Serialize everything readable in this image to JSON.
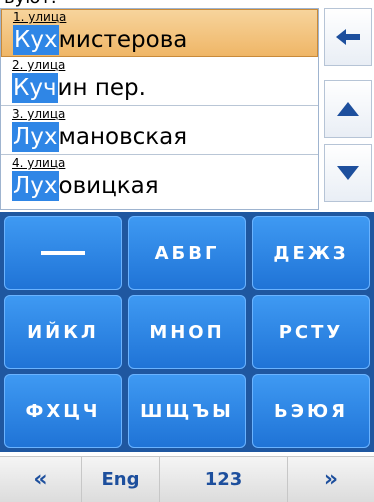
{
  "top_clip_text": "вуют.",
  "list": {
    "items": [
      {
        "caption": "1. улица",
        "prefix": "Кух",
        "rest": "мистерова",
        "selected": true
      },
      {
        "caption": "2. улица",
        "prefix": "Куч",
        "rest": "ин пер.",
        "selected": false
      },
      {
        "caption": "3. улица",
        "prefix": "Лух",
        "rest": "мановская",
        "selected": false
      },
      {
        "caption": "4. улица",
        "prefix": "Лух",
        "rest": "овицкая",
        "selected": false
      }
    ]
  },
  "side_buttons": [
    {
      "icon": "arrow-left-icon"
    },
    {
      "icon": "triangle-up-icon"
    },
    {
      "icon": "triangle-down-icon"
    }
  ],
  "keyboard": {
    "keys": [
      {
        "label": "—"
      },
      {
        "label": "АБВГ"
      },
      {
        "label": "ДЕЖЗ"
      },
      {
        "label": "ИЙКЛ"
      },
      {
        "label": "МНОП"
      },
      {
        "label": "РСТУ"
      },
      {
        "label": "ФХЦЧ"
      },
      {
        "label": "ШЩЪЫ"
      },
      {
        "label": "ЬЭЮЯ"
      }
    ]
  },
  "bottom_bar": {
    "left": "«",
    "lang": "Eng",
    "num": "123",
    "right": "»"
  },
  "colors": {
    "highlight": "#2f86e6",
    "selected_row": "#efb667",
    "key_blue": "#2a7fe0",
    "keyboard_bg": "#1f57a0",
    "bottom_text": "#1d4f9d"
  }
}
